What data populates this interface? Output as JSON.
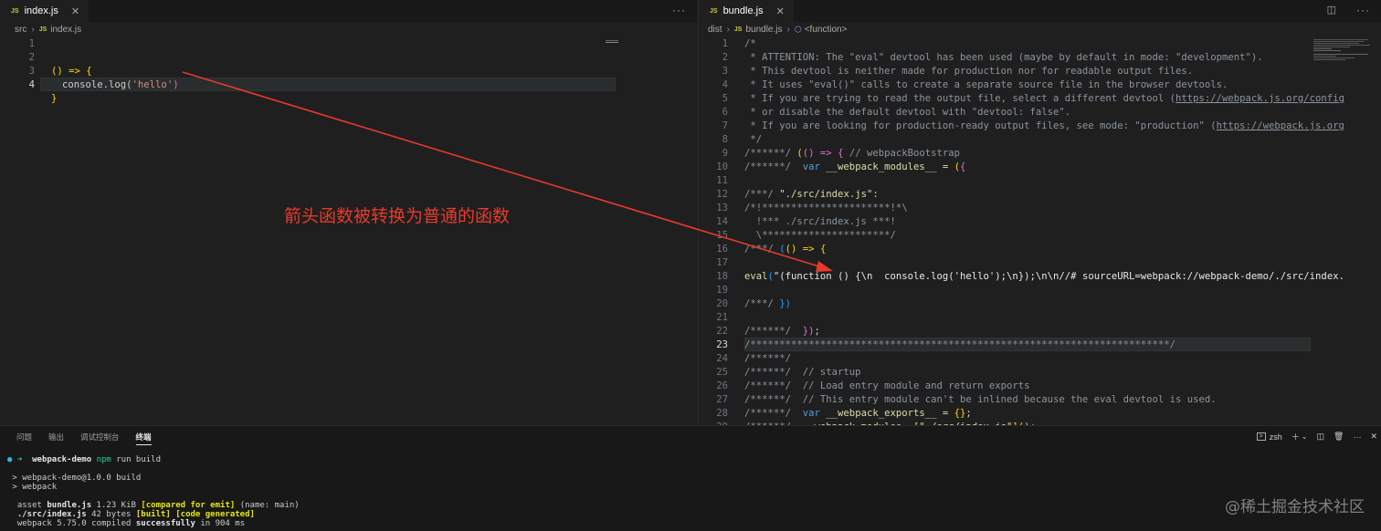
{
  "left_editor": {
    "tab": {
      "icon": "JS",
      "label": "index.js"
    },
    "breadcrumb": [
      "src",
      "index.js"
    ],
    "breadcrumb_icon": "JS",
    "lines": [
      "1",
      "2",
      "3",
      "4"
    ],
    "code": {
      "l2": [
        "() => {"
      ],
      "l3": [
        "console.log(",
        "'hello'",
        ")"
      ],
      "l4": [
        "}"
      ]
    }
  },
  "right_editor": {
    "tab": {
      "icon": "JS",
      "label": "bundle.js"
    },
    "breadcrumb": [
      "dist",
      "bundle.js",
      "<function>"
    ],
    "breadcrumb_icon": "JS",
    "lines": [
      "1",
      "2",
      "3",
      "4",
      "5",
      "6",
      "7",
      "8",
      "9",
      "10",
      "11",
      "12",
      "13",
      "14",
      "15",
      "16",
      "17",
      "18",
      "19",
      "20",
      "21",
      "22",
      "23",
      "24",
      "25",
      "26",
      "27",
      "28",
      "29"
    ],
    "code": {
      "l1": "/*",
      "l2": " * ATTENTION: The \"eval\" devtool has been used (maybe by default in mode: \"development\").",
      "l3": " * This devtool is neither made for production nor for readable output files.",
      "l4": " * It uses \"eval()\" calls to create a separate source file in the browser devtools.",
      "l5a": " * If you are trying to read the output file, select a different devtool (",
      "l5b": "https://webpack.js.org/config",
      "l6": " * or disable the default devtool with \"devtool: false\".",
      "l7a": " * If you are looking for production-ready output files, see mode: \"production\" (",
      "l7b": "https://webpack.js.org",
      "l8": " */",
      "l9a": "/******/ ",
      "l9b": "(",
      "l9c": "() => ",
      "l9d": "{",
      "l9e": " // webpackBootstrap",
      "l10a": "/******/  ",
      "l10b": "var",
      "l10c": " __webpack_modules__ = ",
      "l10d": "(",
      "l10e": "{",
      "l12a": "/***/ ",
      "l12b": "\"./src/index.js\"",
      "l12c": ":",
      "l13": "/*!**********************!*\\",
      "l14": "  !*** ./src/index.js ***!",
      "l15": "  \\**********************/",
      "l16a": "/***/ ",
      "l16b": "(",
      "l16c": "() => ",
      "l16d": "{",
      "l18a": "eval",
      "l18b": "(",
      "l18c": "\"(function () {\\n  console.log('hello');\\n});\\n\\n//# sourceURL=webpack://webpack-demo/./src/index.",
      "l20a": "/***/ ",
      "l20b": "})",
      "l22a": "/******/  ",
      "l22b": "})",
      "l22c": ";",
      "l23": "/************************************************************************/",
      "l24": "/******/",
      "l25": "/******/  // startup",
      "l26": "/******/  // Load entry module and return exports",
      "l27": "/******/  // This entry module can't be inlined because the eval devtool is used.",
      "l28a": "/******/  ",
      "l28b": "var",
      "l28c": " __webpack_exports__ = ",
      "l28d": "{}",
      "l28e": ";",
      "l29a": "/******/  ",
      "l29b": "__webpack_modules__",
      "l29c": "[",
      "l29d": "\"./src/index.js\"",
      "l29e": "](",
      "l29f": ");"
    }
  },
  "panel": {
    "tabs": [
      "问题",
      "输出",
      "调试控制台",
      "终端"
    ],
    "active_tab": "终端",
    "shell": "zsh",
    "terminal": {
      "prompt_dir": "webpack-demo",
      "prompt_cmd": "npm",
      "prompt_args": " run build",
      "out1": "> webpack-demo@1.0.0 build",
      "out2": "> webpack",
      "asset_prefix": "asset ",
      "asset_name": "bundle.js",
      "asset_size": " 1.23 KiB ",
      "asset_flag": "[compared for emit]",
      "asset_suffix": " (name: main)",
      "src_name": "./src/index.js",
      "src_size": " 42 bytes ",
      "src_flags": "[built] [code generated]",
      "compiled_prefix": "webpack 5.75.0 compiled ",
      "compiled_status": "successfully",
      "compiled_suffix": " in 904 ms"
    }
  },
  "annotation": "箭头函数被转换为普通的函数",
  "watermark": "@稀土掘金技术社区",
  "colors": {
    "annotation": "#e8392b",
    "arrow": "#e8392b"
  }
}
